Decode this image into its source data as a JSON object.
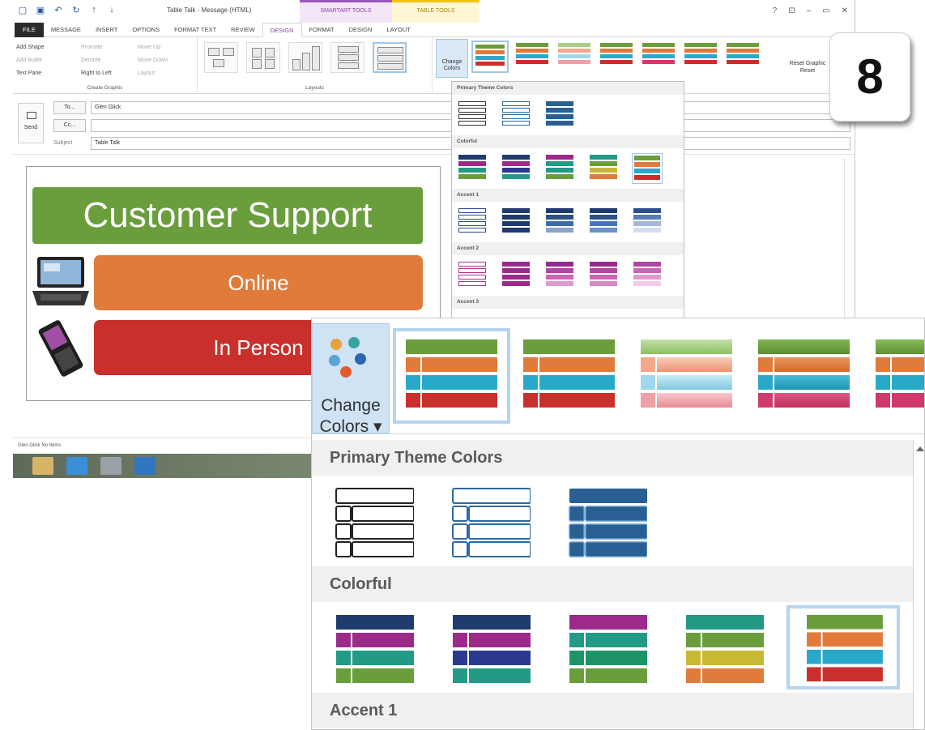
{
  "window": {
    "title": "Table Talk - Message (HTML)",
    "ctx_smartart": "SMARTART TOOLS",
    "ctx_table": "TABLE TOOLS",
    "controls": [
      "?",
      "⊡",
      "–",
      "▭",
      "✕"
    ]
  },
  "tabs": [
    "FILE",
    "MESSAGE",
    "INSERT",
    "OPTIONS",
    "FORMAT TEXT",
    "REVIEW",
    "DESIGN",
    "FORMAT",
    "DESIGN",
    "LAYOUT"
  ],
  "ribbon": {
    "create_graphic": {
      "label": "Create Graphic",
      "add_shape": "Add Shape",
      "add_bullet": "Add Bullet",
      "text_pane": "Text Pane",
      "promote": "Promote",
      "demote": "Demote",
      "right_to_left": "Right to Left",
      "move_up": "Move Up",
      "move_down": "Move Down",
      "layout": "Layout"
    },
    "layouts_label": "Layouts",
    "change_colors_small": "Change Colors",
    "reset": {
      "label": "Reset",
      "button": "Reset Graphic"
    }
  },
  "message": {
    "send": "Send",
    "to_btn": "To...",
    "cc_btn": "Cc...",
    "subject_lbl": "Subject",
    "to_value": "Glen Glick",
    "cc_value": "",
    "subject_value": "Table Talk"
  },
  "smartart": {
    "title": "Customer Support",
    "item1": "Online",
    "item2": "In Person"
  },
  "status": "Glen Glick No Items",
  "small_gallery": {
    "sections": [
      "Primary Theme Colors",
      "Colorful",
      "Accent 1",
      "Accent 2",
      "Accent 3"
    ]
  },
  "step": "8",
  "zoom": {
    "change_colors_line1": "Change",
    "change_colors_line2": "Colors ▾",
    "sections": [
      "Primary Theme Colors",
      "Colorful",
      "Accent 1"
    ]
  },
  "colors": {
    "green": "#6a9e3c",
    "orange": "#e07b3b",
    "teal": "#29a9c9",
    "red": "#c9302c",
    "navy": "#1f3b6e",
    "purple": "#9b2a8a",
    "selection": "#b5d5ee"
  }
}
